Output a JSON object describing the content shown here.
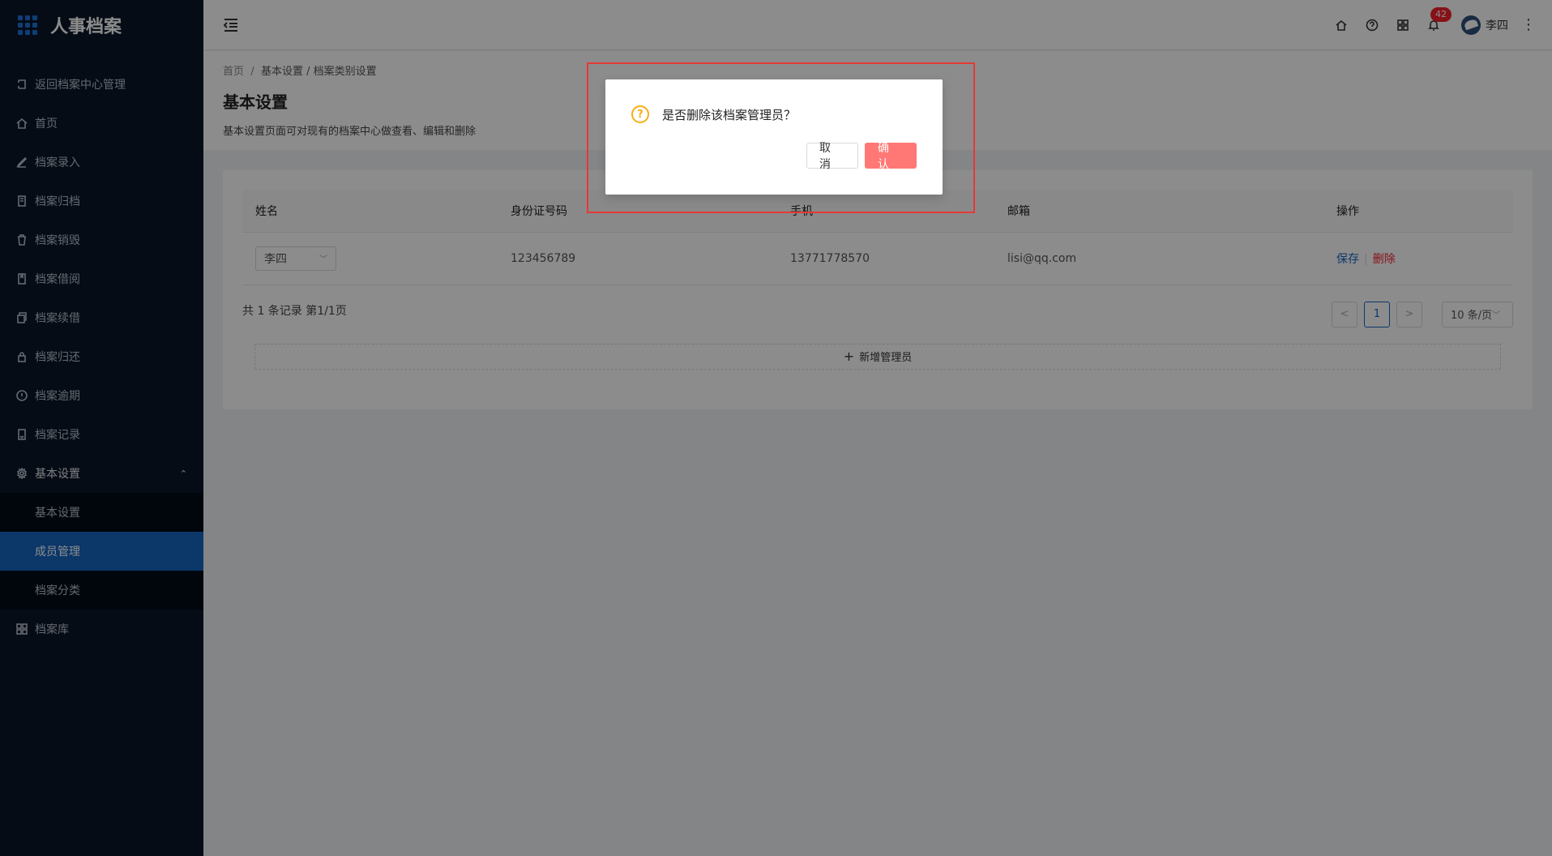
{
  "app": {
    "title": "人事档案"
  },
  "sidebar": {
    "items": [
      {
        "label": "返回档案中心管理",
        "icon": "return-icon"
      },
      {
        "label": "首页",
        "icon": "home-icon"
      },
      {
        "label": "档案录入",
        "icon": "edit-icon"
      },
      {
        "label": "档案归档",
        "icon": "archive-icon"
      },
      {
        "label": "档案销毁",
        "icon": "trash-icon"
      },
      {
        "label": "档案借阅",
        "icon": "book-icon"
      },
      {
        "label": "档案续借",
        "icon": "copy-icon"
      },
      {
        "label": "档案归还",
        "icon": "lock-icon"
      },
      {
        "label": "档案逾期",
        "icon": "alert-icon"
      },
      {
        "label": "档案记录",
        "icon": "record-icon"
      },
      {
        "label": "基本设置",
        "icon": "gear-icon"
      }
    ],
    "submenu": [
      {
        "label": "基本设置"
      },
      {
        "label": "成员管理",
        "active": true
      },
      {
        "label": "档案分类"
      }
    ],
    "last": {
      "label": "档案库",
      "icon": "grid-icon"
    }
  },
  "header": {
    "notification_count": "42",
    "username": "李四"
  },
  "breadcrumb": {
    "home": "首页",
    "sep": "/",
    "path": "基本设置 / 档案类别设置"
  },
  "page": {
    "title": "基本设置",
    "description": "基本设置页面可对现有的档案中心做查看、编辑和删除"
  },
  "table": {
    "columns": [
      "姓名",
      "身份证号码",
      "手机",
      "邮箱",
      "操作"
    ],
    "rows": [
      {
        "name": "李四",
        "id": "123456789",
        "phone": "13771778570",
        "email": "lisi@qq.com",
        "save": "保存",
        "delete": "删除"
      }
    ]
  },
  "pagination": {
    "total": "共 1 条记录 第1/1页",
    "current": "1",
    "page_size": "10 条/页"
  },
  "add_button": "新增管理员",
  "modal": {
    "message": "是否删除该档案管理员？",
    "cancel": "取 消",
    "confirm": "确 认"
  },
  "colors": {
    "sidebar_bg": "#0a1628",
    "active": "#1565c0",
    "danger": "#f5222d",
    "warning": "#faad14"
  }
}
